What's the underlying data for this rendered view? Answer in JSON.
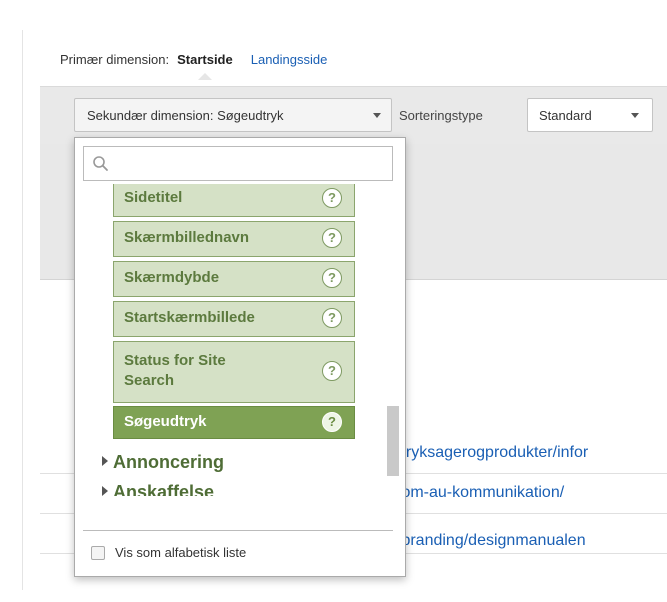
{
  "primary_dimension": {
    "label": "Primær dimension:",
    "active": "Startside",
    "link": "Landingsside"
  },
  "toolbar": {
    "secondary_dimension_label": "Sekundær dimension: Søgeudtryk",
    "sort_label": "Sorteringstype",
    "sort_value": "Standard"
  },
  "dropdown": {
    "search_placeholder": "",
    "items": [
      {
        "label": "Sidetitel",
        "help": "?"
      },
      {
        "label": "Skærmbillednavn",
        "help": "?"
      },
      {
        "label": "Skærmdybde",
        "help": "?"
      },
      {
        "label": "Startskærmbillede",
        "help": "?"
      },
      {
        "label": "Status for Site Search",
        "help": "?"
      },
      {
        "label": "Søgeudtryk",
        "help": "?",
        "selected": true
      }
    ],
    "groups": [
      "Annoncering",
      "Anskaffelse"
    ],
    "alphabetical_label": "Vis som alfabetisk liste"
  },
  "table": {
    "urls": [
      "/tryksagerogprodukter/infor",
      "/om-au-kommunikation/",
      "/branding/designmanualen"
    ]
  },
  "colors": {
    "item_bg": "#d5e1c6",
    "item_selected_bg": "#7fa254",
    "link": "#1a5fb4"
  }
}
